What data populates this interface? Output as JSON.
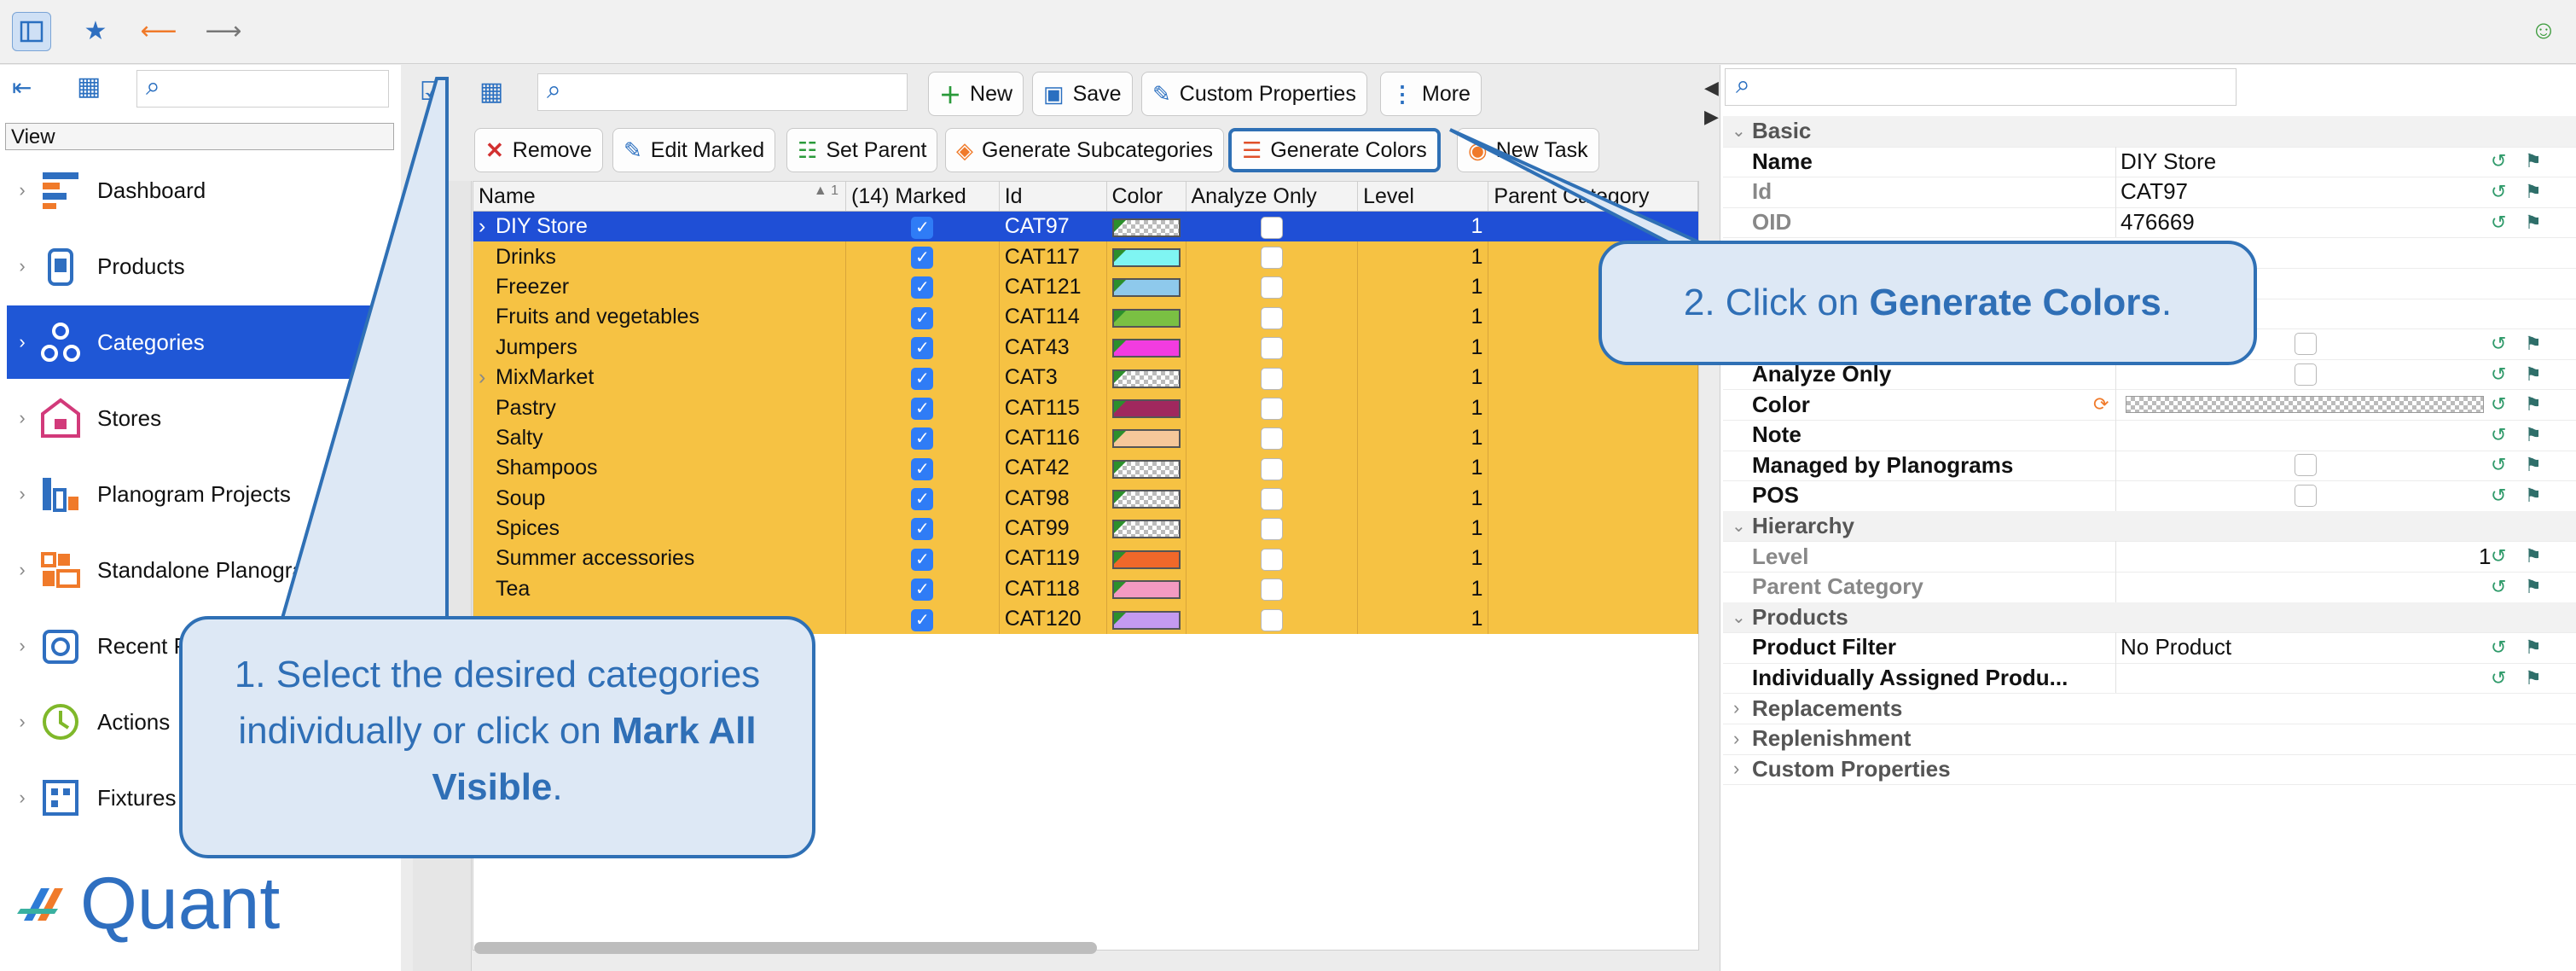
{
  "topbar": {
    "icons": [
      "view-toggle-icon",
      "star-icon",
      "back-arrow-icon",
      "forward-arrow-icon",
      "smiley-icon"
    ]
  },
  "sidebar": {
    "header": "View",
    "items": [
      {
        "label": "Dashboard",
        "icon": "dashboard-icon"
      },
      {
        "label": "Products",
        "icon": "products-icon"
      },
      {
        "label": "Categories",
        "icon": "categories-icon",
        "active": true
      },
      {
        "label": "Stores",
        "icon": "stores-icon"
      },
      {
        "label": "Planogram Projects",
        "icon": "planogram-projects-icon"
      },
      {
        "label": "Standalone Planogra",
        "icon": "standalone-planograms-icon"
      },
      {
        "label": "Recent Pl",
        "icon": "recent-icon"
      },
      {
        "label": "Actions",
        "icon": "actions-icon"
      },
      {
        "label": "Fixtures",
        "icon": "fixtures-icon"
      }
    ],
    "brand": "Quant"
  },
  "toolbar": {
    "row1": [
      "New",
      "Save",
      "Custom Properties",
      "More"
    ],
    "row2": [
      "Remove",
      "Edit Marked",
      "Set Parent",
      "Generate Subcategories",
      "Generate Colors",
      "New Task"
    ]
  },
  "grid": {
    "columns": [
      "Name",
      "(14) Marked",
      "Id",
      "Color",
      "Analyze Only",
      "Level",
      "Parent Category"
    ],
    "sort_indicator": "1",
    "rows": [
      {
        "name": "DIY Store",
        "id": "CAT97",
        "color": "checker",
        "level": "1",
        "selected": true,
        "expand": true
      },
      {
        "name": "Drinks",
        "id": "CAT117",
        "color": "#7ff5f3",
        "level": "1"
      },
      {
        "name": "Freezer",
        "id": "CAT121",
        "color": "#8ec9ec",
        "level": "1"
      },
      {
        "name": "Fruits and vegetables",
        "id": "CAT114",
        "color": "#7ac043",
        "level": "1"
      },
      {
        "name": "Jumpers",
        "id": "CAT43",
        "color": "#f23ce0",
        "level": "1"
      },
      {
        "name": "MixMarket",
        "id": "CAT3",
        "color": "checker",
        "level": "1",
        "expand": true
      },
      {
        "name": "Pastry",
        "id": "CAT115",
        "color": "#a0285e",
        "level": "1"
      },
      {
        "name": "Salty",
        "id": "CAT116",
        "color": "#f5c79a",
        "level": "1"
      },
      {
        "name": "Shampoos",
        "id": "CAT42",
        "color": "checker",
        "level": "1"
      },
      {
        "name": "Soup",
        "id": "CAT98",
        "color": "checker",
        "level": "1"
      },
      {
        "name": "Spices",
        "id": "CAT99",
        "color": "checker",
        "level": "1"
      },
      {
        "name": "Summer accessories",
        "id": "CAT119",
        "color": "#f0682a",
        "level": "1"
      },
      {
        "name": "Tea",
        "id": "CAT118",
        "color": "#f39ac2",
        "level": "1"
      },
      {
        "name": "",
        "id": "CAT120",
        "color": "#c49af0",
        "level": "1"
      }
    ]
  },
  "properties": {
    "sections": {
      "basic": "Basic",
      "hierarchy": "Hierarchy",
      "products": "Products",
      "replacements": "Replacements",
      "replenishment": "Replenishment",
      "custom": "Custom Properties"
    },
    "name_label": "Name",
    "name_value": "DIY Store",
    "id_label": "Id",
    "id_value": "CAT97",
    "oid_label": "OID",
    "oid_value": "476669",
    "analyze_label": "Analyze Only",
    "color_label": "Color",
    "note_label": "Note",
    "managed_label": "Managed by Planograms",
    "pos_label": "POS",
    "level_label": "Level",
    "level_value": "1",
    "parent_label": "Parent Category",
    "filter_label": "Product Filter",
    "filter_value": "No Product",
    "assigned_label": "Individually Assigned Produ..."
  },
  "callouts": {
    "one_prefix": "1. Select the desired categories individually or click on ",
    "one_bold": "Mark All Visible",
    "one_suffix": ".",
    "two_prefix": "2. Click on ",
    "two_bold": "Generate Colors",
    "two_suffix": "."
  },
  "colors": {
    "accent": "#1f57d6",
    "row": "#f6c243",
    "callout_border": "#2f70b5",
    "callout_bg": "#dde8f5"
  }
}
